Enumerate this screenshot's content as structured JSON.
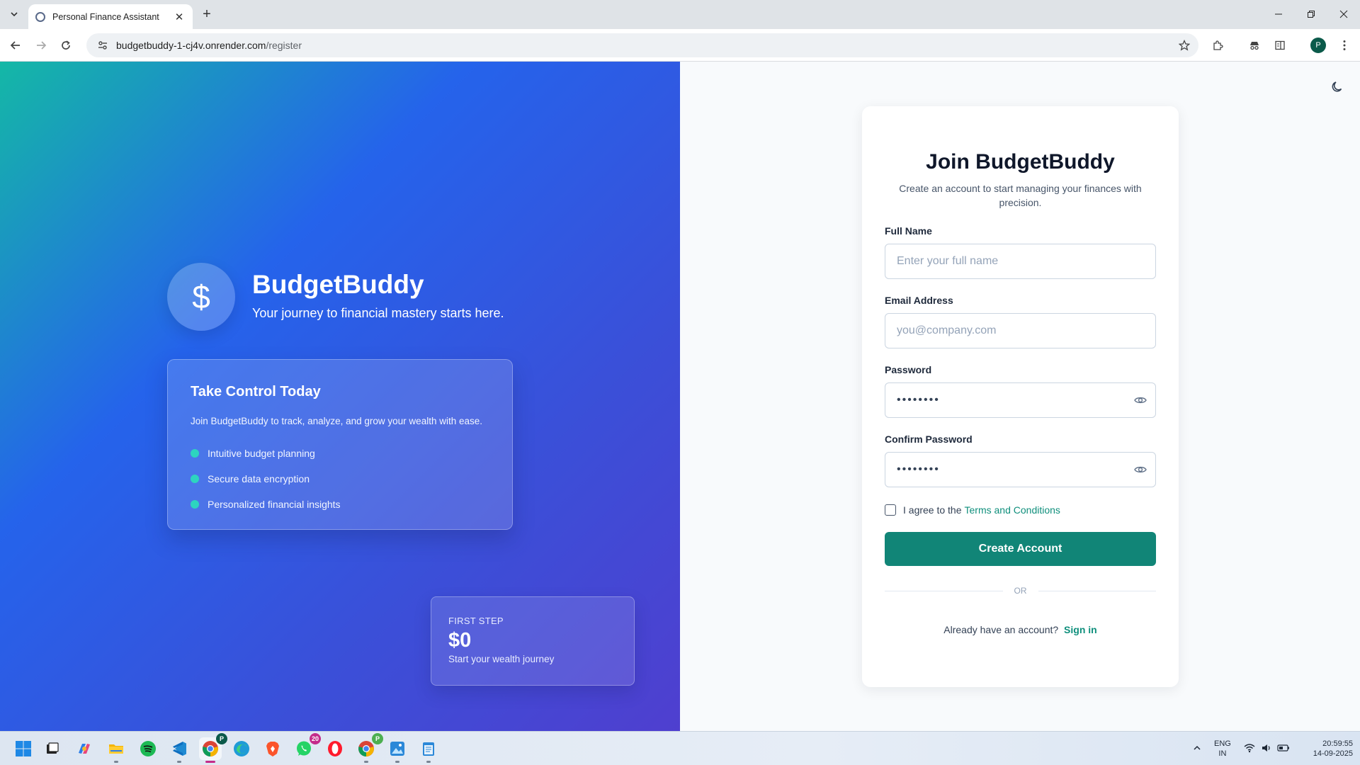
{
  "browser": {
    "tab_title": "Personal Finance Assistant",
    "url_host": "budgetbuddy-1-cj4v.onrender.com",
    "url_path": "/register",
    "profile_initial": "P"
  },
  "hero": {
    "brand_symbol": "$",
    "brand_name": "BudgetBuddy",
    "tagline": "Your journey to financial mastery starts here.",
    "feature_card": {
      "title": "Take Control Today",
      "description": "Join BudgetBuddy to track, analyze, and grow your wealth with ease.",
      "features": [
        "Intuitive budget planning",
        "Secure data encryption",
        "Personalized financial insights"
      ]
    },
    "stat_card": {
      "label": "FIRST STEP",
      "value": "$0",
      "sub": "Start your wealth journey"
    }
  },
  "form": {
    "title": "Join BudgetBuddy",
    "subtitle": "Create an account to start managing your finances with precision.",
    "full_name": {
      "label": "Full Name",
      "placeholder": "Enter your full name"
    },
    "email": {
      "label": "Email Address",
      "placeholder": "you@company.com"
    },
    "password": {
      "label": "Password",
      "placeholder": "••••••••"
    },
    "confirm_password": {
      "label": "Confirm Password",
      "placeholder": "••••••••"
    },
    "agree_text": "I agree to the",
    "terms_link": "Terms and Conditions",
    "submit_label": "Create Account",
    "divider_text": "OR",
    "signin_prompt": "Already have an account?",
    "signin_link": "Sign in"
  },
  "taskbar": {
    "whatsapp_badge": "20",
    "chrome_badge": "P",
    "chrome2_badge": "P",
    "lang_line1": "ENG",
    "lang_line2": "IN",
    "time": "20:59:55",
    "date": "14-09-2025"
  },
  "colors": {
    "accent": "#118577",
    "hero_start": "#14b8a6",
    "hero_mid": "#2563eb",
    "hero_end": "#4f3fcf",
    "feature_dot": "#2dd4bf"
  }
}
